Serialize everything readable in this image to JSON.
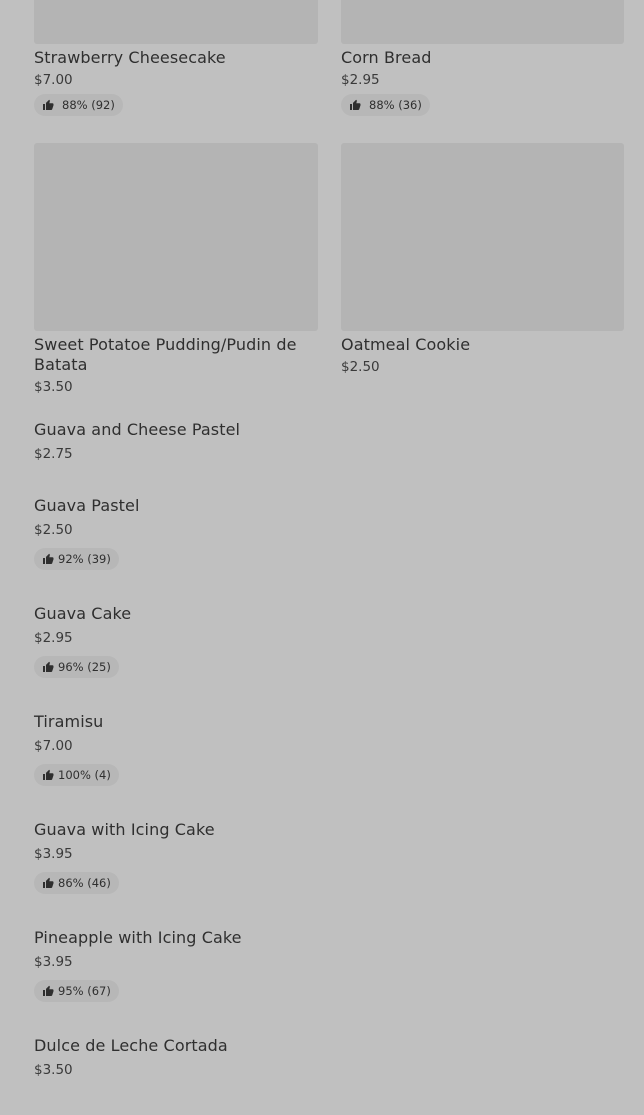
{
  "grid_items": [
    {
      "name": "Strawberry Cheesecake",
      "price": "$7.00",
      "rating": "88% (92)"
    },
    {
      "name": "Corn Bread",
      "price": "$2.95",
      "rating": "88% (36)"
    },
    {
      "name": "Sweet Potatoe Pudding/Pudin de Batata",
      "price": "$3.50"
    },
    {
      "name": "Oatmeal Cookie",
      "price": "$2.50"
    }
  ],
  "list_items": [
    {
      "name": "Guava and Cheese Pastel",
      "price": "$2.75"
    },
    {
      "name": "Guava Pastel",
      "price": "$2.50",
      "rating": "92% (39)"
    },
    {
      "name": "Guava Cake",
      "price": "$2.95",
      "rating": "96% (25)"
    },
    {
      "name": "Tiramisu",
      "price": "$7.00",
      "rating": "100% (4)"
    },
    {
      "name": "Guava with Icing Cake",
      "price": "$3.95",
      "rating": "86% (46)"
    },
    {
      "name": "Pineapple with Icing Cake",
      "price": "$3.95",
      "rating": "95% (67)"
    },
    {
      "name": "Dulce de Leche Cortada",
      "price": "$3.50"
    }
  ],
  "icons": {
    "rating": "thumbs-up-icon"
  },
  "colors": {
    "background": "#c0c0c0",
    "image_placeholder": "#b4b4b4",
    "pill": "#b7b7b7",
    "text": "#2f2f2f"
  }
}
